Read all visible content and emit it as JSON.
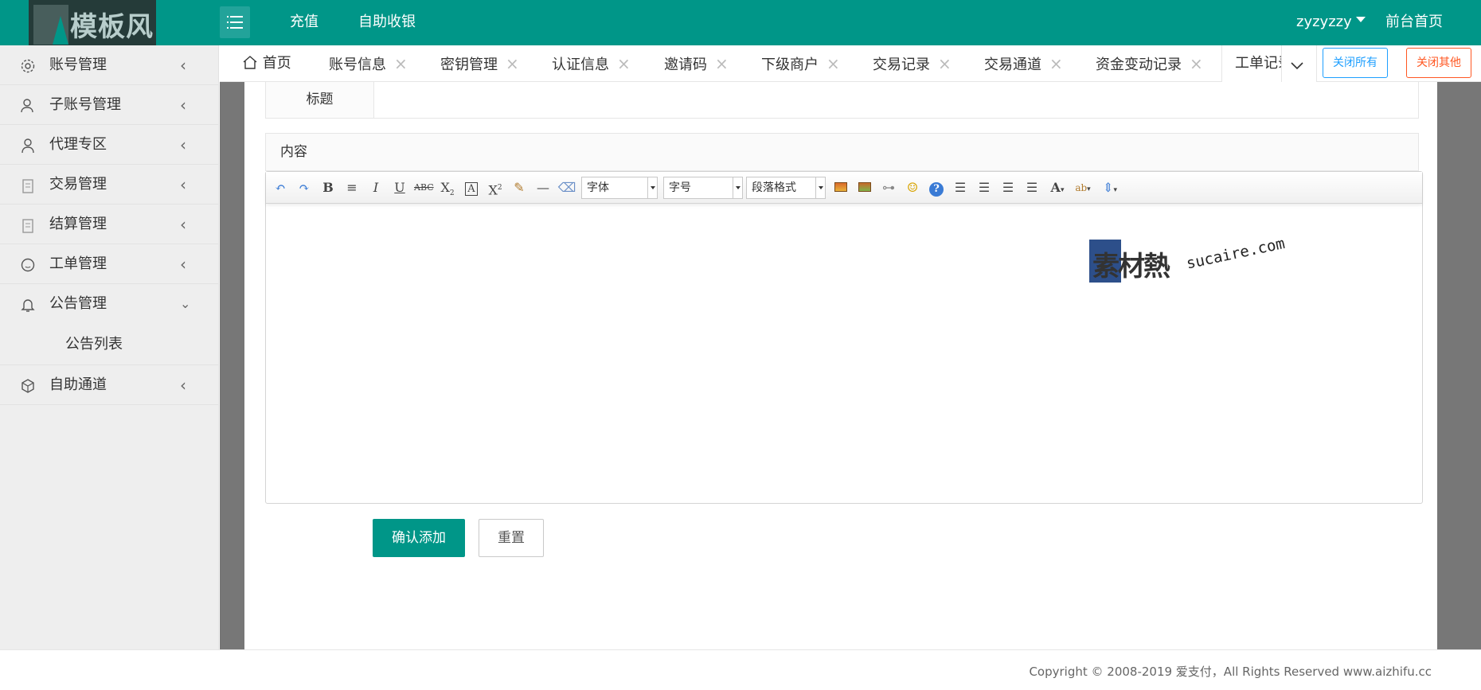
{
  "app": {
    "logo_text": "模板风"
  },
  "header": {
    "nav": [
      "充值",
      "自助收银"
    ],
    "user": "zyzyzzy",
    "home_link": "前台首页"
  },
  "sidebar": {
    "items": [
      {
        "label": "账号管理",
        "icon": "gear-icon"
      },
      {
        "label": "子账号管理",
        "icon": "users-icon"
      },
      {
        "label": "代理专区",
        "icon": "user-icon"
      },
      {
        "label": "交易管理",
        "icon": "clipboard-icon"
      },
      {
        "label": "结算管理",
        "icon": "clipboard-icon"
      },
      {
        "label": "工单管理",
        "icon": "smile-icon"
      },
      {
        "label": "公告管理",
        "icon": "bell-icon",
        "expanded": true
      },
      {
        "label": "自助通道",
        "icon": "cube-icon"
      }
    ],
    "sub_items": [
      "公告列表"
    ]
  },
  "tabs": {
    "items": [
      "首页",
      "账号信息",
      "密钥管理",
      "认证信息",
      "邀请码",
      "下级商户",
      "交易记录",
      "交易通道",
      "资金变动记录",
      "工单记录"
    ],
    "close_all": "关闭所有",
    "close_others": "关闭其他"
  },
  "form": {
    "title_label": "标题",
    "content_label": "内容",
    "confirm": "确认添加",
    "reset": "重置"
  },
  "editor": {
    "font_family": "字体",
    "font_size": "字号",
    "paragraph": "段落格式",
    "toolbar_icons": [
      "undo-icon",
      "redo-icon",
      "bold-icon",
      "indent-icon",
      "italic-icon",
      "underline-icon",
      "strikethrough-icon",
      "subscript-icon",
      "border-icon",
      "superscript-icon",
      "format-brush-icon",
      "horizontal-rule-icon",
      "eraser-icon",
      "image-icon",
      "multi-image-icon",
      "link-icon",
      "emoji-icon",
      "help-icon",
      "align-left-icon",
      "align-right-icon",
      "align-center-icon",
      "align-justify-icon",
      "font-color-icon",
      "highlight-icon",
      "line-height-icon"
    ]
  },
  "watermark": {
    "brand": "素材熱",
    "domain": "sucaire.com"
  },
  "footer": {
    "copyright": "Copyright © 2008-2019 爱支付，All Rights Reserved www.aizhifu.cc"
  },
  "colors": {
    "primary": "#009688",
    "close_all": "#1e9fff",
    "close_others": "#ff5722"
  }
}
